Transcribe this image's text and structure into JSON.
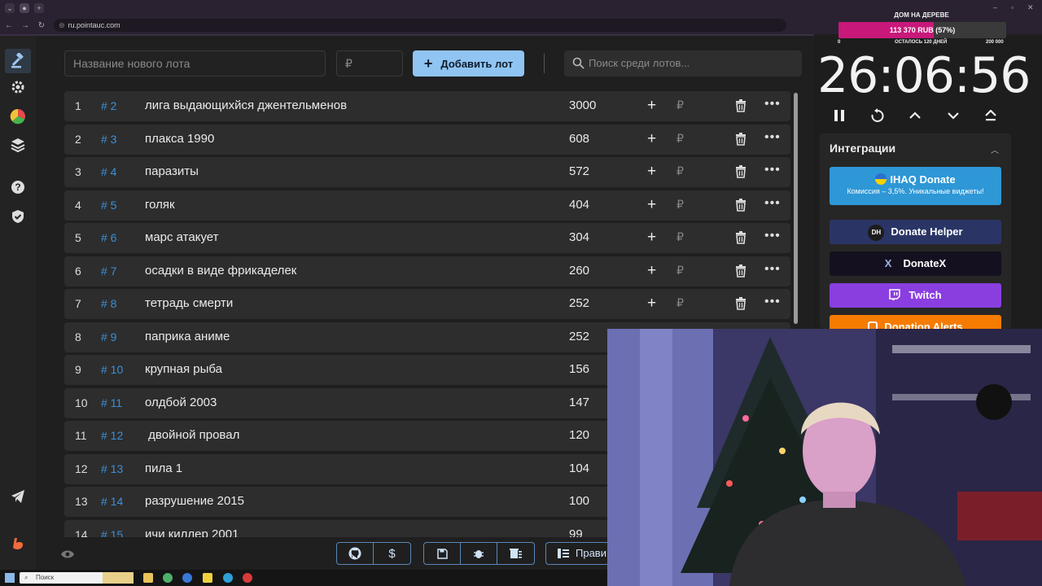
{
  "browser": {
    "url": "ru.pointauc.com",
    "new_tab": "+",
    "win_min": "–",
    "win_max": "▫",
    "win_close": "✕"
  },
  "lot_form": {
    "name_placeholder": "Название нового лота",
    "amount_placeholder": "₽",
    "add_button": "Добавить лот",
    "search_placeholder": "Поиск среди лотов..."
  },
  "lots": [
    {
      "index": "1",
      "number": "# 2",
      "name": "лига выдающихйся джентельменов",
      "amount": "3000"
    },
    {
      "index": "2",
      "number": "# 3",
      "name": "плакса 1990",
      "amount": "608"
    },
    {
      "index": "3",
      "number": "# 4",
      "name": "паразиты",
      "amount": "572"
    },
    {
      "index": "4",
      "number": "# 5",
      "name": "голяк",
      "amount": "404"
    },
    {
      "index": "5",
      "number": "# 6",
      "name": "марс атакует",
      "amount": "304"
    },
    {
      "index": "6",
      "number": "# 7",
      "name": "осадки в виде фрикаделек",
      "amount": "260"
    },
    {
      "index": "7",
      "number": "# 8",
      "name": "тетрадь смерти",
      "amount": "252"
    },
    {
      "index": "8",
      "number": "# 9",
      "name": "паприка аниме",
      "amount": "252"
    },
    {
      "index": "9",
      "number": "# 10",
      "name": "крупная рыба",
      "amount": "156"
    },
    {
      "index": "10",
      "number": "# 11",
      "name": "олдбой 2003",
      "amount": "147"
    },
    {
      "index": "11",
      "number": "# 12",
      "name": " двойной провал",
      "amount": "120"
    },
    {
      "index": "12",
      "number": "# 13",
      "name": "пила 1",
      "amount": "104"
    },
    {
      "index": "13",
      "number": "# 14",
      "name": "разрушение 2015",
      "amount": "100"
    },
    {
      "index": "14",
      "number": "# 15",
      "name": "ичи киллер 2001",
      "amount": "99"
    }
  ],
  "row_actions": {
    "plus": "+",
    "currency": "₽",
    "more": "•••"
  },
  "bottom": {
    "rules_label": "Прави"
  },
  "goal": {
    "title": "ДОМ НА ДЕРЕВЕ",
    "progress_text": "113 370 RUB (57%)",
    "progress_fraction": 0.57,
    "min": "0",
    "remaining": "ОСТАЛОСЬ 120 ДНЕЙ",
    "max": "200 000"
  },
  "timer": {
    "value": "26:06:56"
  },
  "integrations": {
    "title": "Интеграции",
    "services": [
      {
        "label": "IHAQ Donate",
        "sub": "Комиссия – 3,5%. Уникальные виджеты!"
      },
      {
        "label": "Donate Helper",
        "badge": "DH"
      },
      {
        "label": "DonateX",
        "badge": "X"
      },
      {
        "label": "Twitch"
      },
      {
        "label": "Donation Alerts"
      }
    ]
  },
  "taskbar": {
    "search_placeholder": "Поиск"
  },
  "colors": {
    "accent": "#90c4f2",
    "lot_number": "#3d8fd6",
    "goal_fill": "#c8187a",
    "twitch": "#8a3ee0",
    "donation_alerts": "#f57c00"
  }
}
